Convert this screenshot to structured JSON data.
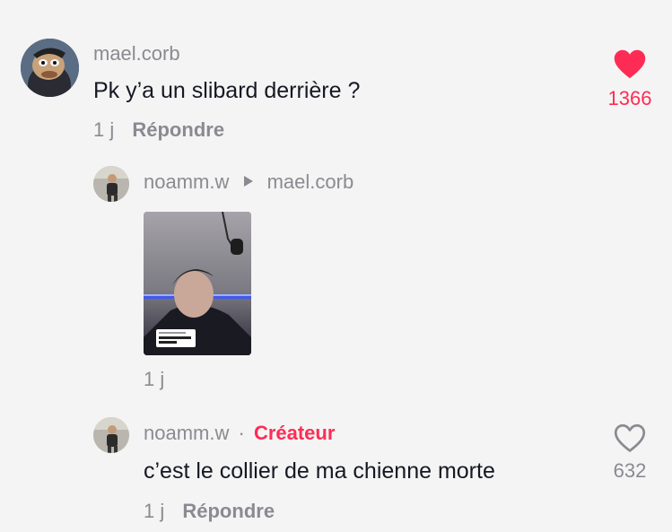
{
  "comment": {
    "username": "mael.corb",
    "text": "Pk y’a un slibard derrière ?",
    "time": "1 j",
    "reply_label": "Répondre",
    "like_count": "1366",
    "liked": true
  },
  "reply_video": {
    "username": "noamm.w",
    "reply_to": "mael.corb",
    "time": "1 j",
    "sticker_text": "Pk y’a un slibard derrière ?"
  },
  "reply_comment": {
    "username": "noamm.w",
    "separator": "·",
    "creator_label": "Créateur",
    "text": "c’est le collier de ma chienne morte",
    "time": "1 j",
    "reply_label": "Répondre",
    "like_count": "632",
    "liked": false
  },
  "colors": {
    "liked_heart": "#fe2c55",
    "creator_label": "#fe2c55",
    "muted_text": "#8a8b91",
    "background": "#f4f4f4"
  },
  "icons": [
    "heart-filled-icon",
    "heart-outline-icon",
    "triangle-right-icon"
  ]
}
